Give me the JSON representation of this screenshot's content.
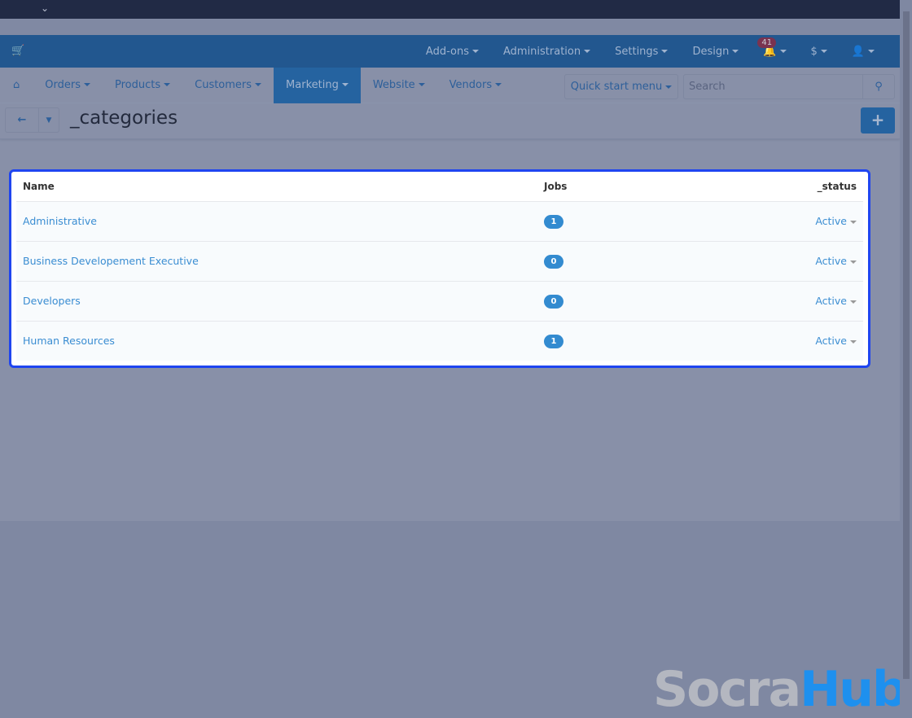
{
  "topbar": {
    "chevron": "⌄"
  },
  "header": {
    "items": [
      {
        "label": "Add-ons"
      },
      {
        "label": "Administration"
      },
      {
        "label": "Settings"
      },
      {
        "label": "Design"
      }
    ],
    "notifications": "41",
    "currency": "$"
  },
  "nav": {
    "items": [
      "Orders",
      "Products",
      "Customers",
      "Marketing",
      "Website",
      "Vendors"
    ],
    "active": "Marketing",
    "quick_start": "Quick start menu",
    "search_placeholder": "Search"
  },
  "page": {
    "title": "_categories"
  },
  "table": {
    "headers": [
      "Name",
      "Jobs",
      "_status"
    ],
    "rows": [
      {
        "name": "Administrative",
        "jobs": "1",
        "status": "Active"
      },
      {
        "name": "Business Developement Executive",
        "jobs": "0",
        "status": "Active"
      },
      {
        "name": "Developers",
        "jobs": "0",
        "status": "Active"
      },
      {
        "name": "Human Resources",
        "jobs": "1",
        "status": "Active"
      }
    ]
  },
  "watermark": {
    "part1": "Socra",
    "part2": "Hub"
  },
  "colors": {
    "header": "#22578f",
    "highlight": "#1f45f0",
    "badge": "#338bd0"
  }
}
